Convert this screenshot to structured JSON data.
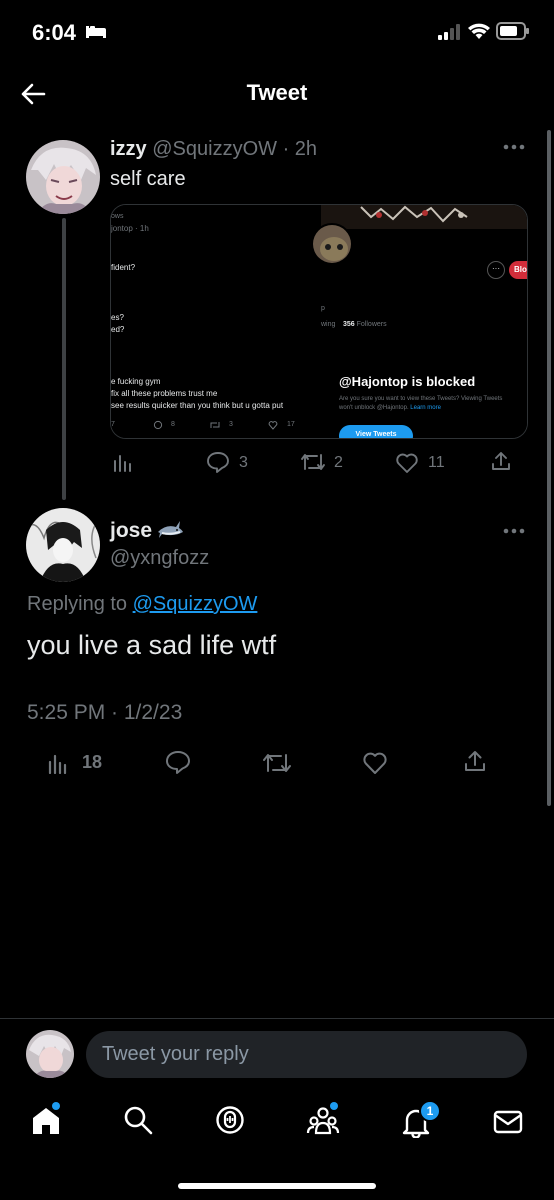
{
  "status_bar": {
    "time": "6:04"
  },
  "header": {
    "title": "Tweet"
  },
  "parent_tweet": {
    "name": "izzy",
    "handle": "@SquizzyOW",
    "time": "· 2h",
    "text": "self care",
    "embed": {
      "left": {
        "frag1": "ows",
        "frag2": "jontop · 1h",
        "frag3": "fident?",
        "frag4": "es?",
        "frag5": "ed?",
        "line1": "e fucking gym",
        "line2": "fix all these problems trust me",
        "line3": "see results quicker than you think but u gotta put",
        "c1": "8",
        "c2": "3",
        "c3": "17",
        "c0": "7"
      },
      "right": {
        "frag_p": "p",
        "wing": "wing",
        "followers_count": "356",
        "followers_label": "Followers",
        "blocked_title": "@Hajontop is blocked",
        "blocked_text": "Are you sure you want to view these Tweets? Viewing Tweets won't unblock @Hajontop.",
        "learn_more": "Learn more",
        "view_button": "View Tweets",
        "blocked_badge": "Blo",
        "more": "···"
      }
    },
    "replies": "3",
    "retweets": "2",
    "likes": "11"
  },
  "main_tweet": {
    "name": "jose",
    "handle": "@yxngfozz",
    "replying_prefix": "Replying to",
    "replying_to": "@SquizzyOW",
    "text": "you live a sad life wtf",
    "timestamp": "5:25 PM · 1/2/23",
    "views": "18"
  },
  "reply_bar": {
    "placeholder": "Tweet your reply"
  },
  "tab_bar": {
    "notifications_badge": "1"
  },
  "colors": {
    "accent": "#1d9bf0",
    "background": "#000000",
    "muted": "#71767b"
  }
}
